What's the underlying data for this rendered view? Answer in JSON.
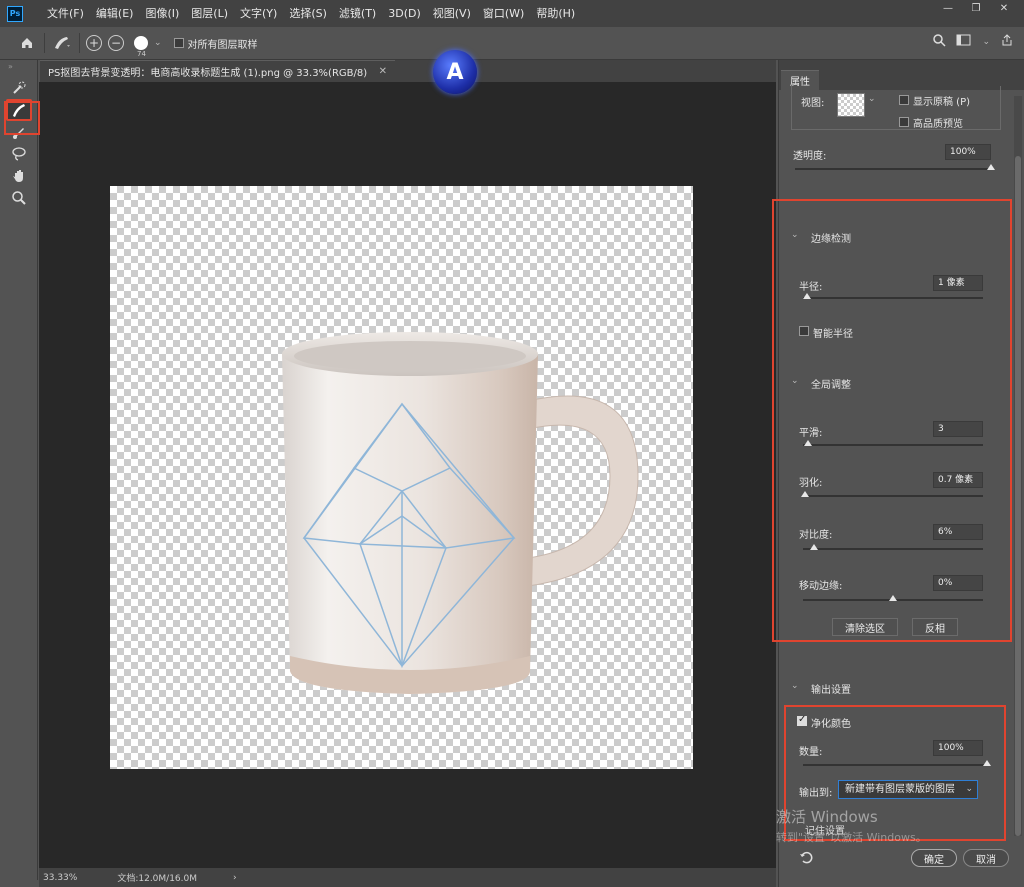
{
  "app": {
    "logo_text": "Ps"
  },
  "menu": [
    "文件(F)",
    "编辑(E)",
    "图像(I)",
    "图层(L)",
    "文字(Y)",
    "选择(S)",
    "滤镜(T)",
    "3D(D)",
    "视图(V)",
    "窗口(W)",
    "帮助(H)"
  ],
  "window_controls": {
    "minimize": "—",
    "restore": "❐",
    "close": "✕"
  },
  "options": {
    "brush_size": "74",
    "sample_all_layers_label": "对所有图层取样",
    "sample_all_layers_checked": false
  },
  "document": {
    "tab_title": "PS抠图去背景变透明：电商高收录标题生成 (1).png @ 33.3%(RGB/8)",
    "close": "✕"
  },
  "watermark_logo": "A",
  "status": {
    "zoom": "33.33%",
    "doc_size": "文档:12.0M/16.0M",
    "arrow": "›"
  },
  "panel": {
    "tab": "属性",
    "view_label": "视图:",
    "show_original": "显示原稿 (P)",
    "high_quality_preview": "高品质预览",
    "opacity_label": "透明度:",
    "opacity_value": "100%",
    "opacity_level": 1.0,
    "edge_detection": {
      "title": "边缘检测",
      "radius_label": "半径:",
      "radius_value": "1 像素",
      "radius_level": 0.02,
      "smart_radius": "智能半径"
    },
    "global_refine": {
      "title": "全局调整",
      "smooth_label": "平滑:",
      "smooth_value": "3",
      "smooth_level": 0.03,
      "feather_label": "羽化:",
      "feather_value": "0.7 像素",
      "feather_level": 0.01,
      "contrast_label": "对比度:",
      "contrast_value": "6%",
      "contrast_level": 0.06,
      "shift_edge_label": "移动边缘:",
      "shift_edge_value": "0%",
      "shift_edge_level": 0.5,
      "clear_selection": "清除选区",
      "invert": "反相"
    },
    "output": {
      "title": "输出设置",
      "decontaminate": "净化颜色",
      "decontaminate_checked": true,
      "amount_label": "数量:",
      "amount_value": "100%",
      "amount_level": 1.0,
      "output_to_label": "输出到:",
      "output_to_value": "新建带有图层蒙版的图层",
      "remember": "记住设置"
    },
    "ok": "确定",
    "cancel": "取消"
  },
  "windows_watermark": {
    "line1": "激活 Windows",
    "line2": "转到\"设置\"以激活 Windows。"
  }
}
